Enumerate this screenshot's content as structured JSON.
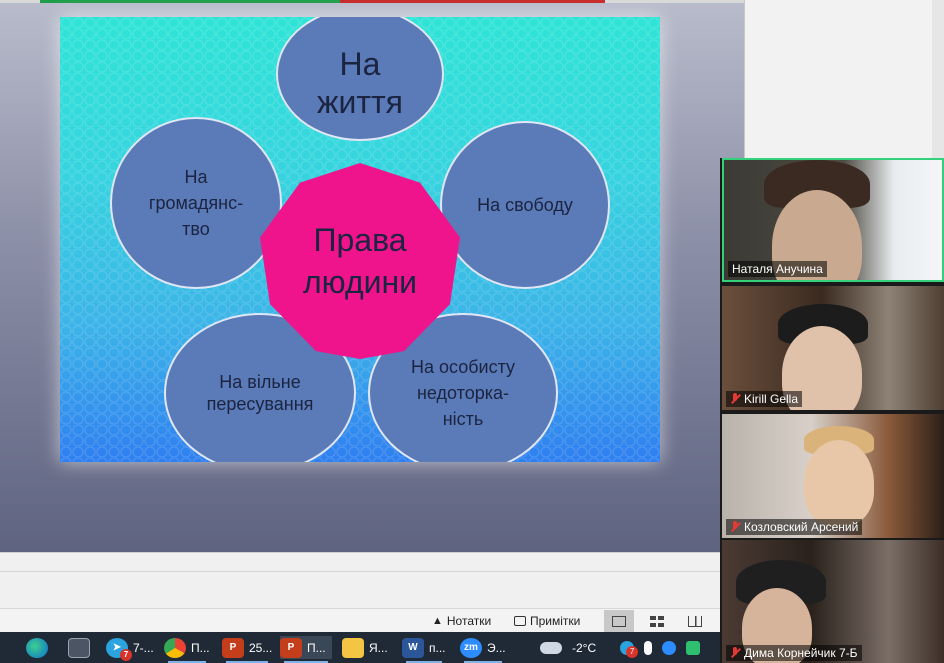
{
  "slide": {
    "center": "Права\nлюдини",
    "top": "На\nжиття",
    "left": "На\nгромадянс-\nтво",
    "right": "На свободу",
    "bottom_left": "На вільне\nпересування",
    "bottom_right": "На особисту\nнедоторка-\nність",
    "colors": {
      "center": "#f0148c",
      "petal": "#5b7ab8",
      "bg_top": "#2fe4d6",
      "bg_bottom": "#2f7ff0"
    }
  },
  "status_bar": {
    "notes_label": "Нотатки",
    "comments_label": "Примітки",
    "views": [
      "normal-view-icon",
      "slide-sorter-icon",
      "reading-view-icon"
    ]
  },
  "participants": [
    {
      "name": "Наталя Анучина",
      "muted": false,
      "active_speaker": true
    },
    {
      "name": "Kirill Gella",
      "muted": true
    },
    {
      "name": "Козловский Арсений",
      "muted": true
    },
    {
      "name": "Дима Корнейчик 7-Б",
      "muted": true
    }
  ],
  "taskbar": {
    "items": [
      {
        "icon": "edge-icon",
        "label": ""
      },
      {
        "icon": "calculator-icon",
        "label": ""
      },
      {
        "icon": "telegram-icon",
        "label": "7-...",
        "badge": "7"
      },
      {
        "icon": "chrome-icon",
        "label": "П..."
      },
      {
        "icon": "powerpoint-icon",
        "label": "25..."
      },
      {
        "icon": "powerpoint-icon",
        "label": "П..."
      },
      {
        "icon": "file-explorer-icon",
        "label": "Я..."
      },
      {
        "icon": "word-icon",
        "label": "п..."
      },
      {
        "icon": "zoom-icon",
        "label": "Э..."
      }
    ],
    "tray": {
      "weather_icon": "cloud-icon",
      "temperature": "-2°C",
      "telegram_badge": "7"
    }
  }
}
